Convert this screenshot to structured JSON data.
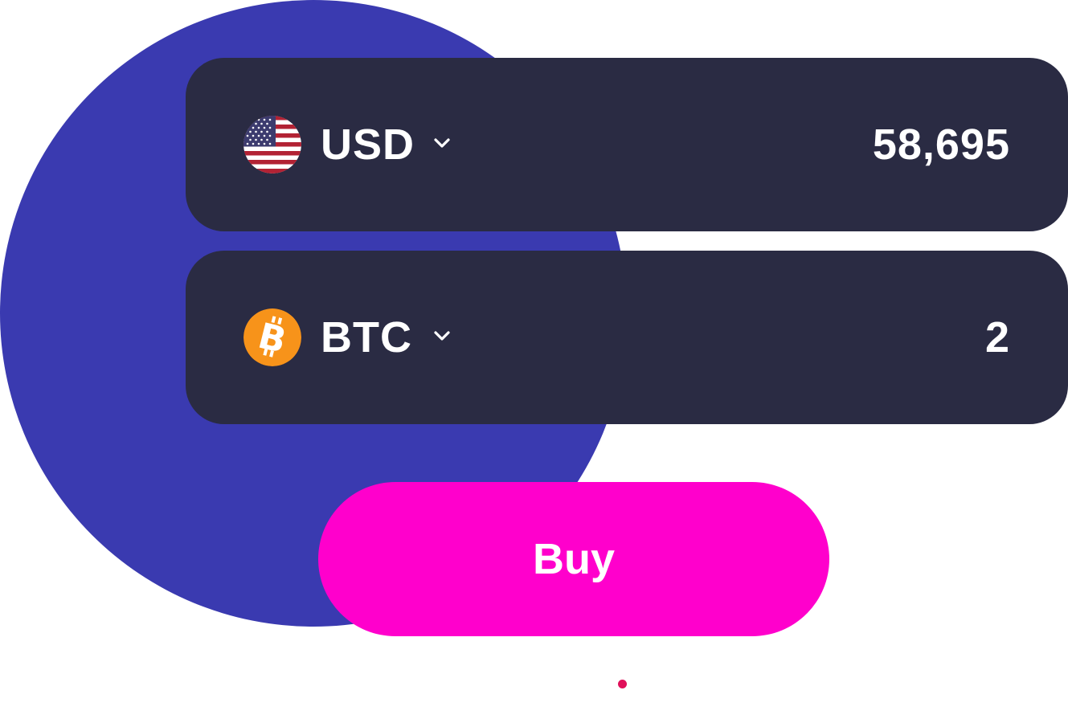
{
  "from": {
    "currency_code": "USD",
    "icon": "us-flag-icon",
    "amount": "58,695"
  },
  "to": {
    "currency_code": "BTC",
    "icon": "bitcoin-icon",
    "amount": "2"
  },
  "buy_button": {
    "label": "Buy"
  },
  "colors": {
    "background_circle": "#3a3ab0",
    "card": "#2a2b43",
    "buy_button": "#ff00cc",
    "bitcoin_orange": "#f7931a",
    "indicator_dot": "#e0105a"
  }
}
